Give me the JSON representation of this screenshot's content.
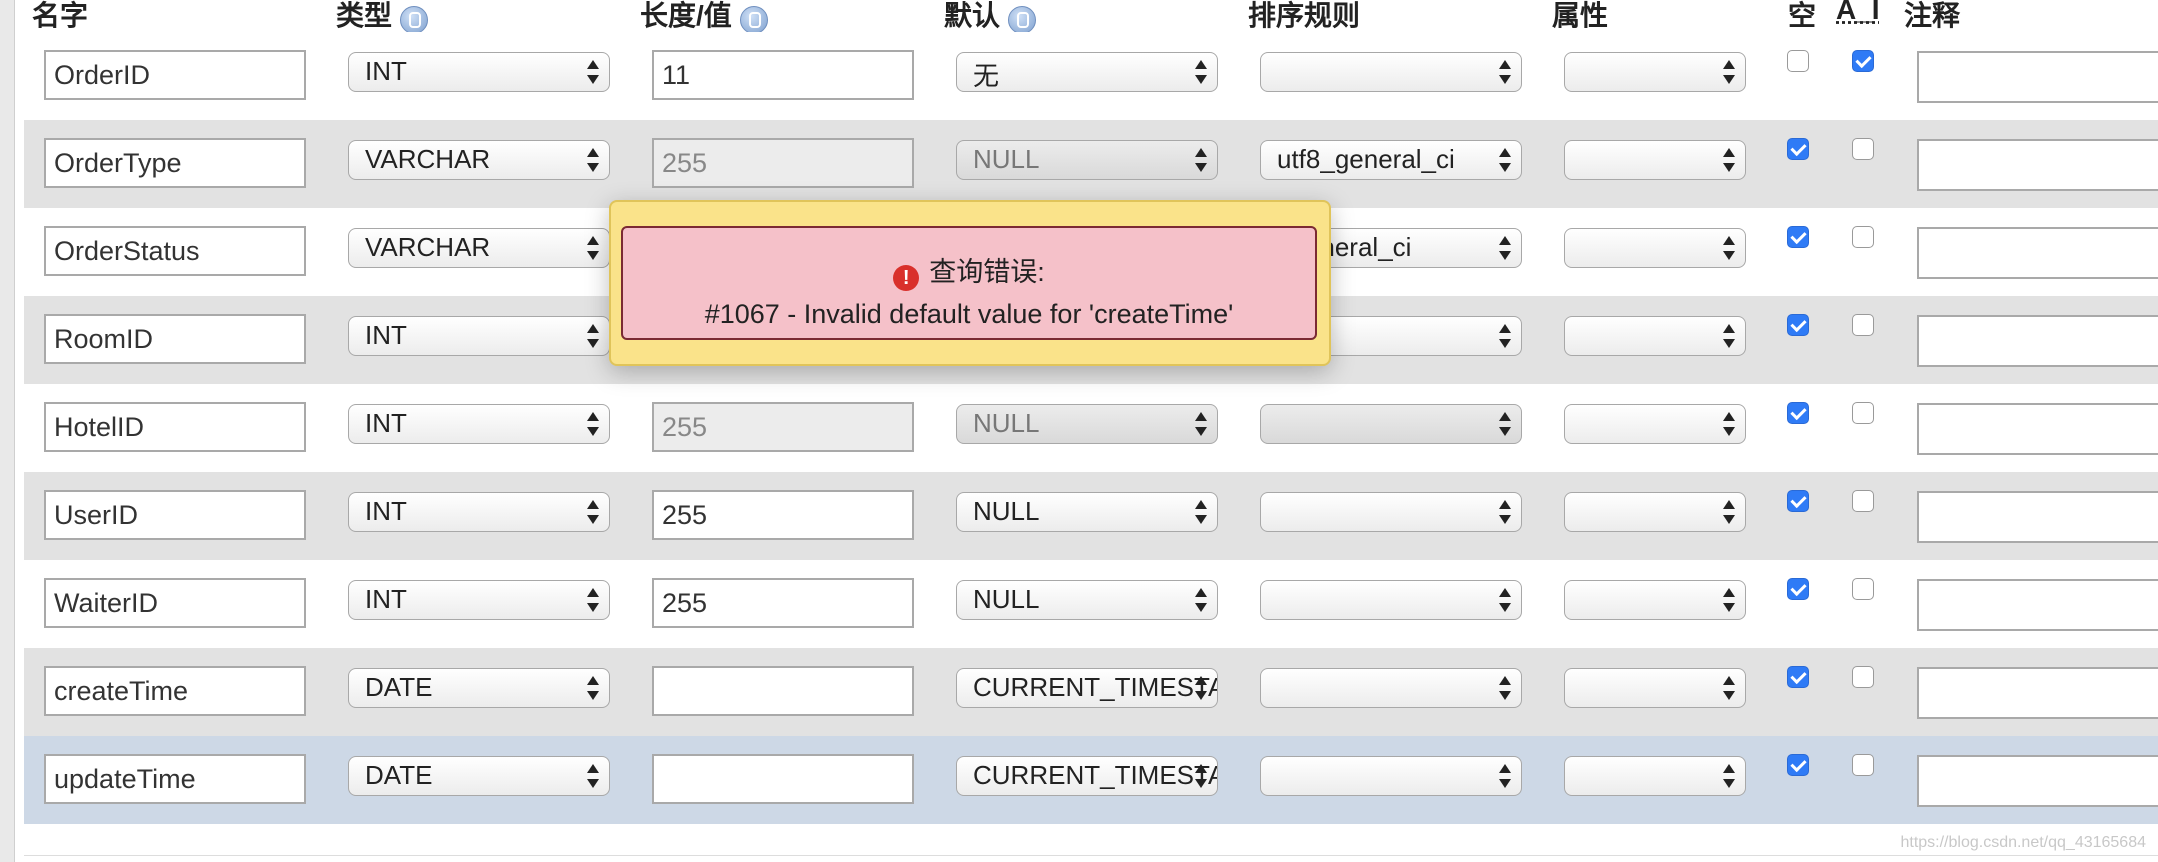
{
  "headers": {
    "name": "名字",
    "type": "类型",
    "length": "长度/值",
    "default": "默认",
    "collation": "排序规则",
    "attributes": "属性",
    "null": "空",
    "ai": "A_I",
    "comment": "注释"
  },
  "rows": [
    {
      "name": "OrderID",
      "type": "INT",
      "length": "11",
      "default": "无",
      "collation": "",
      "attributes": "",
      "null": false,
      "ai": true
    },
    {
      "name": "OrderType",
      "type": "VARCHAR",
      "length": "255",
      "default": "NULL",
      "collation": "utf8_general_ci",
      "attributes": "",
      "null": true,
      "ai": false
    },
    {
      "name": "OrderStatus",
      "type": "VARCHAR",
      "length": "",
      "default": "",
      "collation": "_general_ci",
      "attributes": "",
      "null": true,
      "ai": false
    },
    {
      "name": "RoomID",
      "type": "INT",
      "length": "",
      "default": "",
      "collation": "",
      "attributes": "",
      "null": true,
      "ai": false
    },
    {
      "name": "HotelID",
      "type": "INT",
      "length": "255",
      "default": "NULL",
      "collation": "",
      "attributes": "",
      "null": true,
      "ai": false
    },
    {
      "name": "UserID",
      "type": "INT",
      "length": "255",
      "default": "NULL",
      "collation": "",
      "attributes": "",
      "null": true,
      "ai": false
    },
    {
      "name": "WaiterID",
      "type": "INT",
      "length": "255",
      "default": "NULL",
      "collation": "",
      "attributes": "",
      "null": true,
      "ai": false
    },
    {
      "name": "createTime",
      "type": "DATE",
      "length": "",
      "default": "CURRENT_TIMESTAMP",
      "collation": "",
      "attributes": "",
      "null": true,
      "ai": false
    },
    {
      "name": "updateTime",
      "type": "DATE",
      "length": "",
      "default": "CURRENT_TIMESTAMP",
      "collation": "",
      "attributes": "",
      "null": true,
      "ai": false
    }
  ],
  "error": {
    "title": "查询错误:",
    "message": "#1067 - Invalid default value for 'createTime'"
  },
  "watermark": "https://blog.csdn.net/qq_43165684"
}
